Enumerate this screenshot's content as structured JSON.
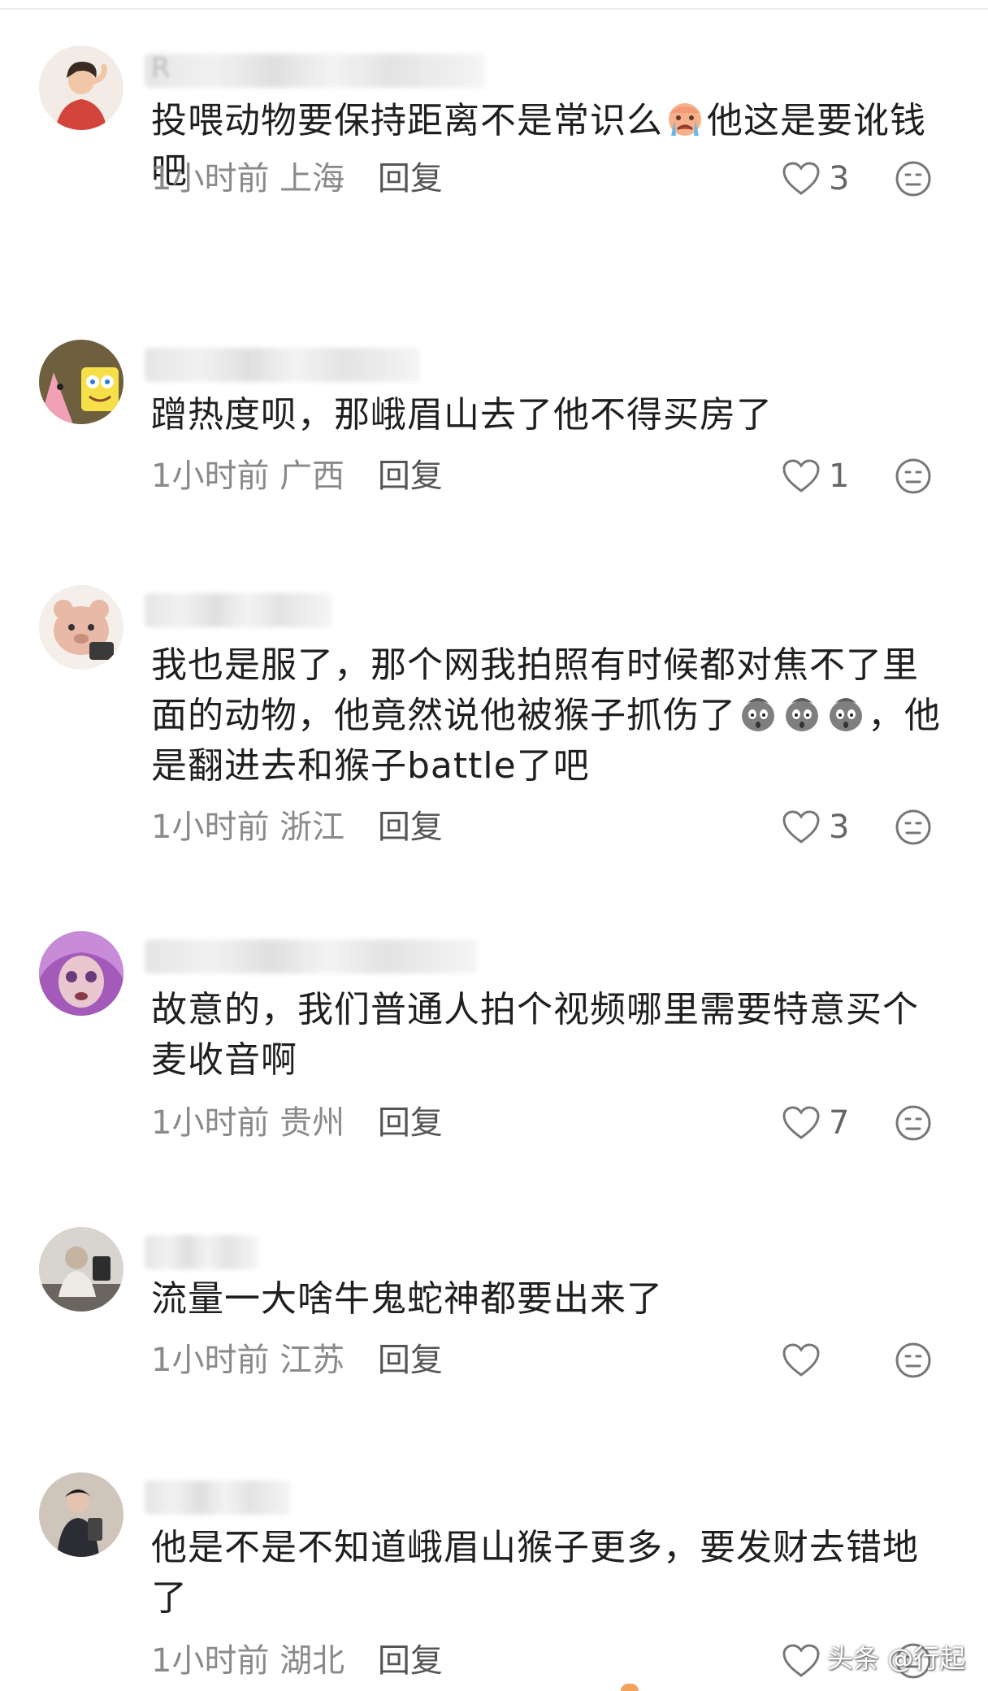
{
  "comments": [
    {
      "name_ghost": "R",
      "text_before": "投喂动物要保持距离不是常识么",
      "emoji": "crying-face-icon",
      "emoji_count": 1,
      "text_after": "他这是要讹钱吧",
      "time": "1小时前",
      "location": "上海",
      "reply": "回复",
      "likes": "3"
    },
    {
      "name_ghost": "",
      "text_before": "蹭热度呗，那峨眉山去了他不得买房了",
      "emoji": "",
      "emoji_count": 0,
      "text_after": "",
      "time": "1小时前",
      "location": "广西",
      "reply": "回复",
      "likes": "1"
    },
    {
      "name_ghost": "",
      "text_before": "我也是服了，那个网我拍照有时候都对焦不了里面的动物，他竟然说他被猴子抓伤了",
      "emoji": "shocked-face-icon",
      "emoji_count": 3,
      "text_after": "，他是翻进去和猴子battle了吧",
      "time": "1小时前",
      "location": "浙江",
      "reply": "回复",
      "likes": "3"
    },
    {
      "name_ghost": "",
      "text_before": "故意的，我们普通人拍个视频哪里需要特意买个麦收音啊",
      "emoji": "",
      "emoji_count": 0,
      "text_after": "",
      "time": "1小时前",
      "location": "贵州",
      "reply": "回复",
      "likes": "7"
    },
    {
      "name_ghost": "",
      "text_before": "流量一大啥牛鬼蛇神都要出来了",
      "emoji": "",
      "emoji_count": 0,
      "text_after": "",
      "time": "1小时前",
      "location": "江苏",
      "reply": "回复",
      "likes": ""
    },
    {
      "name_ghost": "",
      "text_before": "他是不是不知道峨眉山猴子更多，要发财去错地了",
      "emoji": "",
      "emoji_count": 0,
      "text_after": "",
      "time": "1小时前",
      "location": "湖北",
      "reply": "回复",
      "likes": ""
    }
  ],
  "watermark": "头条 @行起",
  "colors": {
    "text": "#1f1f1f",
    "meta": "#8a8a8a",
    "icon": "#777777"
  }
}
